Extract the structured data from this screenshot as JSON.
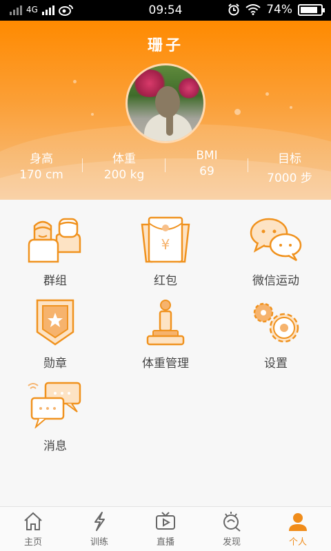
{
  "status_bar": {
    "time": "09:54",
    "network": "4G",
    "battery": "74%"
  },
  "profile": {
    "name": "珊子",
    "stats": [
      {
        "label": "身高",
        "value": "170 cm"
      },
      {
        "label": "体重",
        "value": "200 kg"
      },
      {
        "label": "BMI",
        "value": "69"
      },
      {
        "label": "目标",
        "value": "7000 步"
      }
    ]
  },
  "grid": {
    "items": [
      {
        "label": "群组",
        "icon": "group-icon"
      },
      {
        "label": "红包",
        "icon": "red-packet-icon"
      },
      {
        "label": "微信运动",
        "icon": "wechat-sport-icon"
      },
      {
        "label": "勋章",
        "icon": "medal-icon"
      },
      {
        "label": "体重管理",
        "icon": "weight-scale-icon"
      },
      {
        "label": "设置",
        "icon": "settings-gears-icon"
      },
      {
        "label": "消息",
        "icon": "message-icon"
      }
    ]
  },
  "tabbar": {
    "tabs": [
      {
        "label": "主页",
        "icon": "home-icon"
      },
      {
        "label": "训练",
        "icon": "lightning-icon"
      },
      {
        "label": "直播",
        "icon": "tv-play-icon"
      },
      {
        "label": "发现",
        "icon": "discover-icon"
      },
      {
        "label": "个人",
        "icon": "person-icon",
        "active": true
      }
    ]
  },
  "colors": {
    "accent": "#f08c1a",
    "header_top": "#ff8a00",
    "icon_stroke": "#f0921e",
    "icon_fill": "#fde3c4"
  }
}
